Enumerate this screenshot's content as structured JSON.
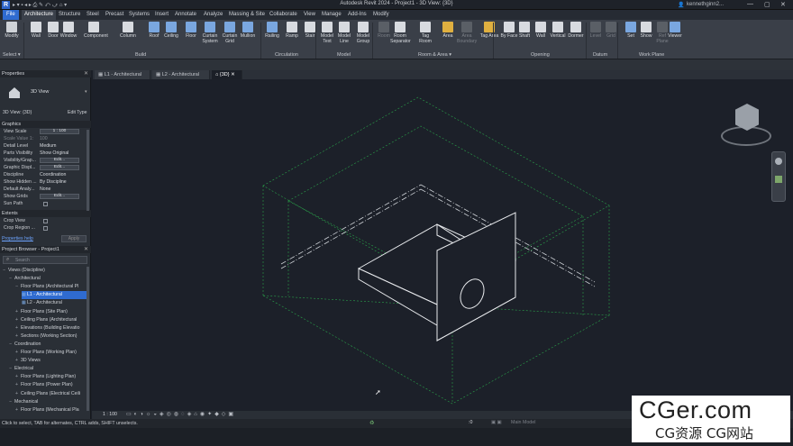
{
  "app": {
    "title": "Autodesk Revit 2024 - Project1 - 3D View: {3D}",
    "logo_letter": "R",
    "user": "kennethginn2...",
    "window_controls": [
      "—",
      "▢",
      "✕"
    ],
    "qat_label": "▸ ▾ ▪ ◂ ▸ ⎙ ✎ ⤺ ⤻ ⌂ ▾"
  },
  "menu": {
    "tabs": [
      "File",
      "Architecture",
      "Structure",
      "Steel",
      "Precast",
      "Systems",
      "Insert",
      "Annotate",
      "Analyze",
      "Massing & Site",
      "Collaborate",
      "View",
      "Manage",
      "Add-Ins",
      "Modify"
    ],
    "active": "Architecture"
  },
  "ribbon": {
    "buttons": [
      {
        "label": "Modify",
        "icon": "cursor-icon",
        "dim": false
      },
      {
        "label": "Wall",
        "icon": "wall-icon",
        "dim": false
      },
      {
        "label": "Door",
        "icon": "door-icon",
        "dim": false
      },
      {
        "label": "Window",
        "icon": "window-icon",
        "dim": false
      },
      {
        "label": "Component",
        "icon": "component-icon",
        "dim": false
      },
      {
        "label": "Column",
        "icon": "column-icon",
        "dim": false
      },
      {
        "label": "Roof",
        "icon": "roof-icon",
        "dim": false
      },
      {
        "label": "Ceiling",
        "icon": "ceiling-icon",
        "dim": false
      },
      {
        "label": "Floor",
        "icon": "floor-icon",
        "dim": false
      },
      {
        "label": "Curtain System",
        "icon": "curtain-system-icon",
        "dim": false
      },
      {
        "label": "Curtain Grid",
        "icon": "curtain-grid-icon",
        "dim": false
      },
      {
        "label": "Mullion",
        "icon": "mullion-icon",
        "dim": false
      },
      {
        "label": "Railing",
        "icon": "railing-icon",
        "dim": false
      },
      {
        "label": "Ramp",
        "icon": "ramp-icon",
        "dim": false
      },
      {
        "label": "Stair",
        "icon": "stair-icon",
        "dim": false
      },
      {
        "label": "Model Text",
        "icon": "model-text-icon",
        "dim": false
      },
      {
        "label": "Model Line",
        "icon": "model-line-icon",
        "dim": false
      },
      {
        "label": "Model Group",
        "icon": "model-group-icon",
        "dim": false
      },
      {
        "label": "Room",
        "icon": "room-icon",
        "dim": true
      },
      {
        "label": "Room Separator",
        "icon": "room-separator-icon",
        "dim": false
      },
      {
        "label": "Tag Room",
        "icon": "tag-room-icon",
        "dim": false
      },
      {
        "label": "Area",
        "icon": "area-icon",
        "dim": false
      },
      {
        "label": "Area Boundary",
        "icon": "area-boundary-icon",
        "dim": true
      },
      {
        "label": "Tag Area",
        "icon": "tag-area-icon",
        "dim": false
      },
      {
        "label": "By Face",
        "icon": "by-face-icon",
        "dim": false
      },
      {
        "label": "Shaft",
        "icon": "shaft-icon",
        "dim": false
      },
      {
        "label": "Wall",
        "icon": "opening-wall-icon",
        "dim": false
      },
      {
        "label": "Vertical",
        "icon": "vertical-icon",
        "dim": false
      },
      {
        "label": "Dormer",
        "icon": "dormer-icon",
        "dim": false
      },
      {
        "label": "Level",
        "icon": "level-icon",
        "dim": true
      },
      {
        "label": "Grid",
        "icon": "grid-icon",
        "dim": true
      },
      {
        "label": "Set",
        "icon": "set-icon",
        "dim": false
      },
      {
        "label": "Show",
        "icon": "show-icon",
        "dim": false
      },
      {
        "label": "Ref Plane",
        "icon": "ref-plane-icon",
        "dim": true
      },
      {
        "label": "Viewer",
        "icon": "viewer-icon",
        "dim": false
      }
    ],
    "panels": [
      "Select ▾",
      "Build",
      "Circulation",
      "Model",
      "Room & Area ▾",
      "Opening",
      "Datum",
      "Work Plane"
    ]
  },
  "doc_tabs": [
    "L1 - Architectural",
    "L2 - Architectural",
    "{3D}"
  ],
  "properties": {
    "header": "Properties",
    "type_name": "3D View",
    "view_selector": "3D View: {3D}",
    "edit_type": "Edit Type",
    "group": "Graphics",
    "rows": [
      {
        "k": "View Scale",
        "v": "1 : 100",
        "kind": "box"
      },
      {
        "k": "Scale Value   1:",
        "v": "100",
        "kind": "dim"
      },
      {
        "k": "Detail Level",
        "v": "Medium",
        "kind": "text"
      },
      {
        "k": "Parts Visibility",
        "v": "Show Original",
        "kind": "text"
      },
      {
        "k": "Visibility/Grap...",
        "v": "Edit...",
        "kind": "box"
      },
      {
        "k": "Graphic Displ...",
        "v": "Edit...",
        "kind": "box"
      },
      {
        "k": "Discipline",
        "v": "Coordination",
        "kind": "text"
      },
      {
        "k": "Show Hidden ...",
        "v": "By Discipline",
        "kind": "text"
      },
      {
        "k": "Default Analy...",
        "v": "None",
        "kind": "text"
      },
      {
        "k": "Show Grids",
        "v": "Edit...",
        "kind": "box"
      },
      {
        "k": "Sun Path",
        "v": "",
        "kind": "check"
      }
    ],
    "group2": "Extents",
    "rows2": [
      {
        "k": "Crop View",
        "v": "",
        "kind": "check"
      },
      {
        "k": "Crop Region ...",
        "v": "",
        "kind": "check"
      }
    ],
    "help": "Properties help",
    "apply": "Apply"
  },
  "browser": {
    "header": "Project Browser - Project1",
    "search_placeholder": "Search",
    "items": [
      {
        "label": "Views (Discipline)",
        "level": 0,
        "toggle": "−",
        "sel": false
      },
      {
        "label": "Architectural",
        "level": 1,
        "toggle": "−",
        "sel": false
      },
      {
        "label": "Floor Plans (Architectural Pl",
        "level": 2,
        "toggle": "−",
        "sel": false
      },
      {
        "label": "L1 - Architectural",
        "level": 3,
        "toggle": "",
        "sel": true
      },
      {
        "label": "L2 - Architectural",
        "level": 3,
        "toggle": "",
        "sel": false
      },
      {
        "label": "Floor Plans (Site Plan)",
        "level": 2,
        "toggle": "+",
        "sel": false
      },
      {
        "label": "Ceiling Plans (Architectural",
        "level": 2,
        "toggle": "+",
        "sel": false
      },
      {
        "label": "Elevations (Building Elevatio",
        "level": 2,
        "toggle": "+",
        "sel": false
      },
      {
        "label": "Sections (Working Section)",
        "level": 2,
        "toggle": "+",
        "sel": false
      },
      {
        "label": "Coordination",
        "level": 1,
        "toggle": "−",
        "sel": false
      },
      {
        "label": "Floor Plans (Working Plan)",
        "level": 2,
        "toggle": "+",
        "sel": false
      },
      {
        "label": "3D Views",
        "level": 2,
        "toggle": "+",
        "sel": false
      },
      {
        "label": "Electrical",
        "level": 1,
        "toggle": "−",
        "sel": false
      },
      {
        "label": "Floor Plans (Lighting Plan)",
        "level": 2,
        "toggle": "+",
        "sel": false
      },
      {
        "label": "Floor Plans (Power Plan)",
        "level": 2,
        "toggle": "+",
        "sel": false
      },
      {
        "label": "Ceiling Plans (Electrical Ceili",
        "level": 2,
        "toggle": "+",
        "sel": false
      },
      {
        "label": "Mechanical",
        "level": 1,
        "toggle": "−",
        "sel": false
      },
      {
        "label": "Floor Plans (Mechanical Pla",
        "level": 2,
        "toggle": "+",
        "sel": false
      }
    ]
  },
  "view_controls": {
    "scale": "1 : 100"
  },
  "status": {
    "message": "Click to select, TAB for alternates, CTRL adds, SHIFT unselects.",
    "counter": ":0",
    "model": "Main Model"
  },
  "watermark": {
    "line1": "CGer.com",
    "line2": "CG资源 CG网站"
  },
  "colors": {
    "accent": "#2f6bd0",
    "viewport_bg": "#1c2029",
    "ribbon_bg": "#3a3f48",
    "green_lines": "#2aa14a"
  }
}
